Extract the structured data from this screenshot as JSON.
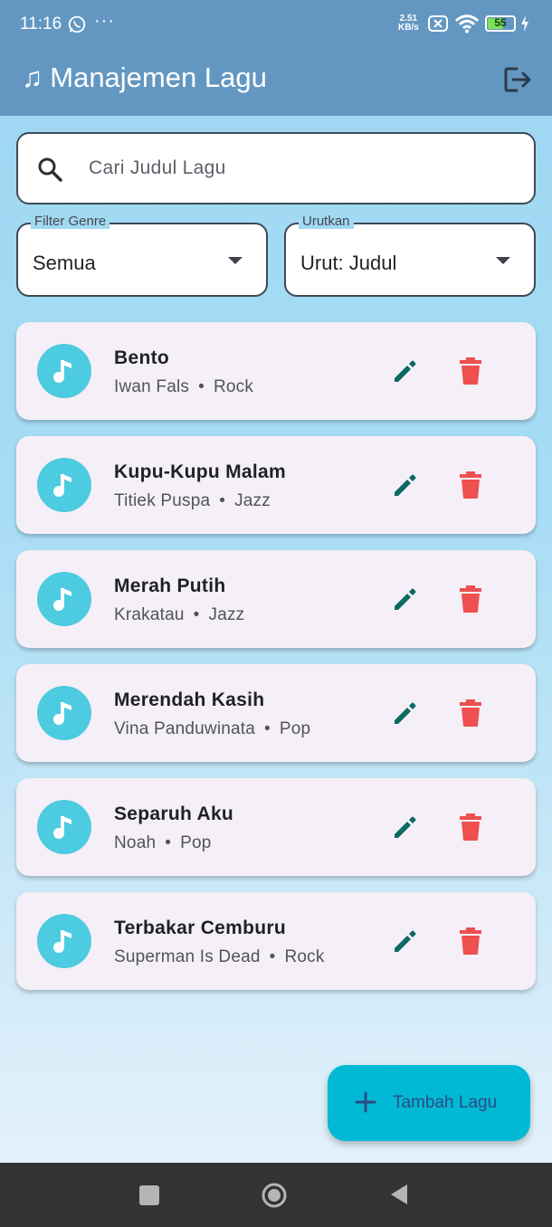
{
  "status_bar": {
    "time": "11:16",
    "overflow": "···",
    "net_speed_value": "2.51",
    "net_speed_unit": "KB/s",
    "battery": "55",
    "icons": [
      "whatsapp-icon",
      "no-sim-icon",
      "wifi-icon",
      "battery-icon",
      "charging-icon"
    ]
  },
  "app_bar": {
    "note_icon": "♫",
    "title": "Manajemen Lagu",
    "logout_icon": "logout-icon",
    "color": "#6397c2"
  },
  "search": {
    "placeholder": "Cari Judul Lagu",
    "icon": "search-icon"
  },
  "filters": {
    "genre": {
      "label": "Filter Genre",
      "value": "Semua"
    },
    "sort": {
      "label": "Urutkan",
      "value": "Urut: Judul"
    }
  },
  "songs": [
    {
      "title": "Bento",
      "artist": "Iwan Fals",
      "genre": "Rock"
    },
    {
      "title": "Kupu-Kupu Malam",
      "artist": "Titiek Puspa",
      "genre": "Jazz"
    },
    {
      "title": "Merah Putih",
      "artist": "Krakatau",
      "genre": "Jazz"
    },
    {
      "title": "Merendah Kasih",
      "artist": "Vina Panduwinata",
      "genre": "Pop"
    },
    {
      "title": "Separuh Aku",
      "artist": "Noah",
      "genre": "Pop"
    },
    {
      "title": "Terbakar Cemburu",
      "artist": "Superman Is Dead",
      "genre": "Rock"
    }
  ],
  "separator": "•",
  "fab": {
    "label": "Tambah Lagu",
    "icon": "plus-icon",
    "color": "#00b9d4"
  },
  "colors": {
    "edit": "#0a6b62",
    "delete": "#ef4f4f",
    "avatar": "#4dcbe0"
  }
}
